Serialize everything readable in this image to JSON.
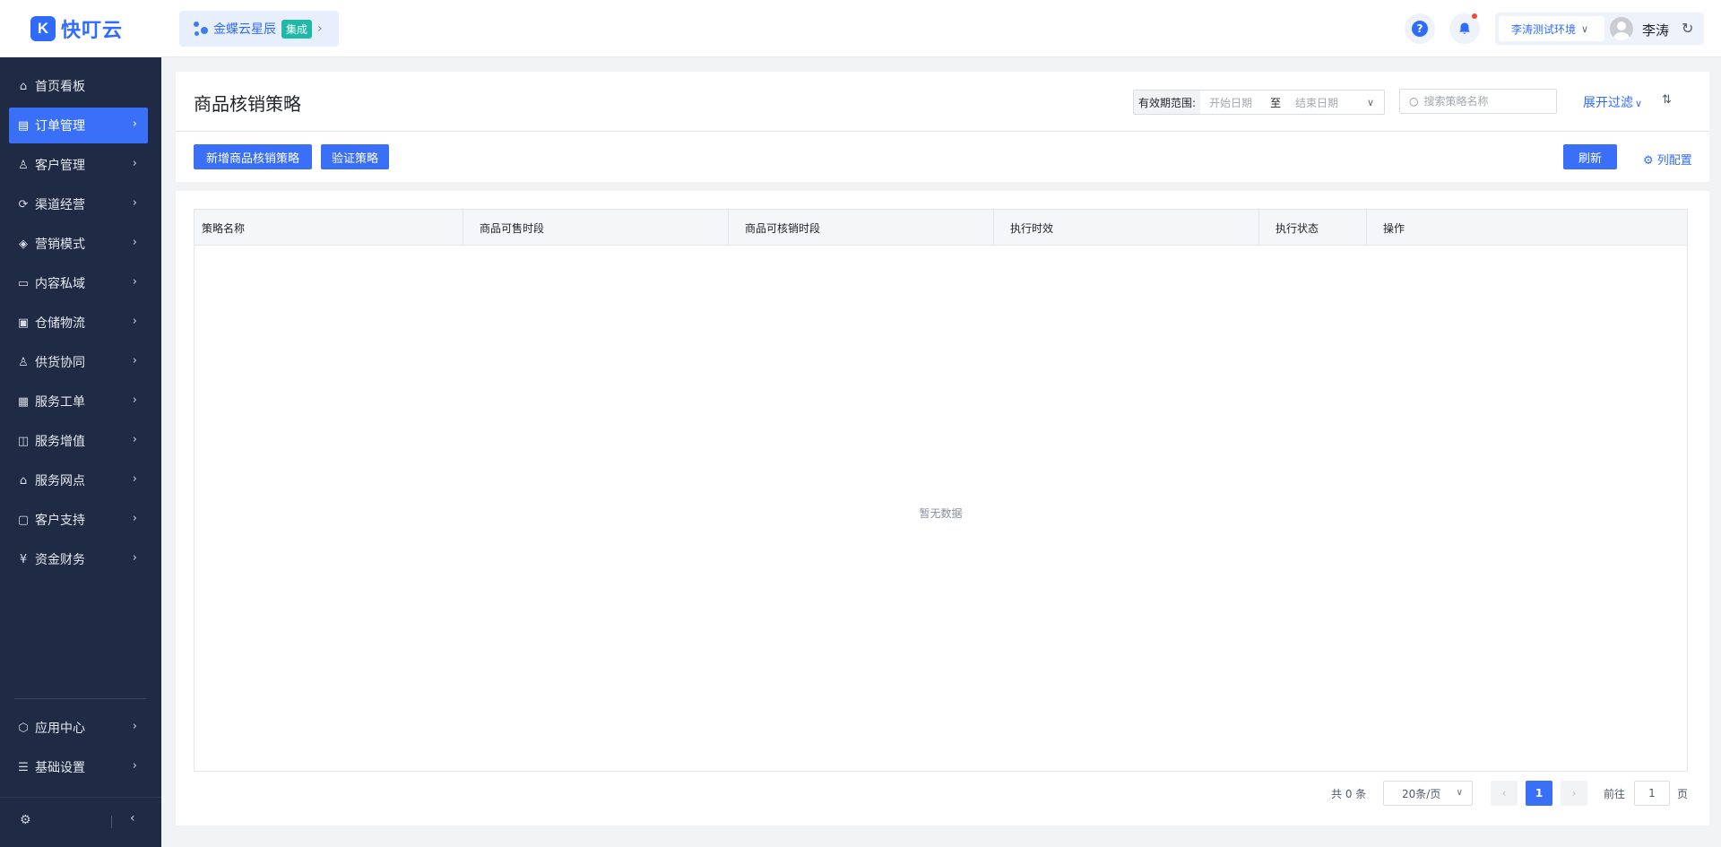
{
  "header": {
    "logo_mark": "K",
    "logo_text": "快叮云",
    "integration": {
      "label": "金蝶云星辰",
      "badge": "集成",
      "chevron": "›"
    },
    "help_icon": "?",
    "bell_icon": "🔔",
    "env": "李涛测试环境",
    "user": "李涛",
    "refresh_icon": "↻"
  },
  "sidebar": {
    "items": [
      {
        "label": "首页看板",
        "icon": "⌂",
        "icon_name": "home-icon"
      },
      {
        "label": "订单管理",
        "icon": "▤",
        "icon_name": "order-icon",
        "active": true
      },
      {
        "label": "客户管理",
        "icon": "♙",
        "icon_name": "user-icon"
      },
      {
        "label": "渠道经营",
        "icon": "⟳",
        "icon_name": "channel-icon"
      },
      {
        "label": "营销模式",
        "icon": "◈",
        "icon_name": "tag-icon"
      },
      {
        "label": "内容私域",
        "icon": "▭",
        "icon_name": "image-icon"
      },
      {
        "label": "仓储物流",
        "icon": "▣",
        "icon_name": "box-icon"
      },
      {
        "label": "供货协同",
        "icon": "♙",
        "icon_name": "supply-icon"
      },
      {
        "label": "服务工单",
        "icon": "▦",
        "icon_name": "ticket-icon"
      },
      {
        "label": "服务增值",
        "icon": "◫",
        "icon_name": "bag-icon"
      },
      {
        "label": "服务网点",
        "icon": "⌂",
        "icon_name": "store-icon"
      },
      {
        "label": "客户支持",
        "icon": "▢",
        "icon_name": "support-icon"
      },
      {
        "label": "资金财务",
        "icon": "¥",
        "icon_name": "finance-icon"
      }
    ],
    "bottom_items": [
      {
        "label": "应用中心",
        "icon": "⬡",
        "icon_name": "app-center-icon"
      },
      {
        "label": "基础设置",
        "icon": "☰",
        "icon_name": "settings-list-icon"
      }
    ],
    "chevron": "›",
    "footer_gear": "⚙",
    "footer_collapse": "‹"
  },
  "page": {
    "title": "商品核销策略",
    "filter": {
      "range_label": "有效期范围:",
      "start_placeholder": "开始日期",
      "to": "至",
      "end_placeholder": "结束日期",
      "search_placeholder": "搜索策略名称",
      "expand_filter": "展开过滤",
      "sort_icon": "⇅"
    },
    "buttons": {
      "add": "新增商品核销策略",
      "verify": "验证策略",
      "refresh": "刷新",
      "col_config": "⚙ 列配置"
    }
  },
  "table": {
    "columns": [
      "策略名称",
      "商品可售时段",
      "商品可核销时段",
      "执行时效",
      "执行状态",
      "操作"
    ],
    "rows": [],
    "empty_text": "暂无数据"
  },
  "pagination": {
    "total_text": "共 0 条",
    "page_size": "20条/页",
    "prev": "‹",
    "current": "1",
    "next": "›",
    "goto_label": "前往",
    "goto_value": "1",
    "goto_unit": "页"
  }
}
